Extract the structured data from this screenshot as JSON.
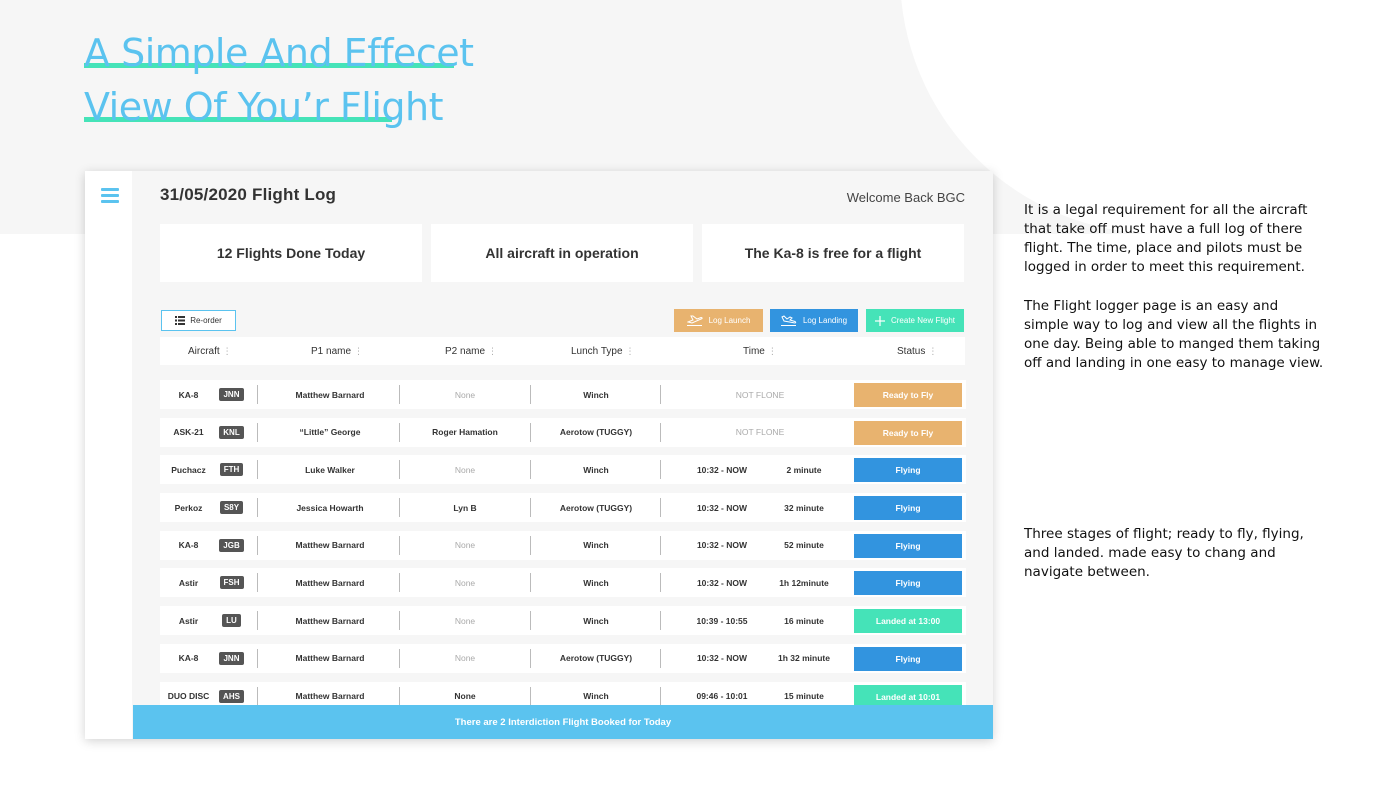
{
  "headline": {
    "line1": "A Simple And Effecet",
    "line2": "View Of You’r Flight"
  },
  "colors": {
    "brand_blue": "#5bc3ef",
    "accent_green": "#45e3b8",
    "ready_orange": "#e8b36f",
    "flying_blue": "#3294df"
  },
  "app": {
    "menu_icon": "hamburger-menu-icon",
    "title": "31/05/2020 Flight Log",
    "welcome": "Welcome Back BGC",
    "stats": [
      "12 Flights Done Today",
      "All aircraft in operation",
      "The Ka-8 is free for a flight"
    ],
    "toolbar": {
      "reorder_label": "Re-order",
      "reorder_icon": "list-icon",
      "log_launch_label": "Log Launch",
      "log_launch_icon": "plane-takeoff-icon",
      "log_landing_label": "Log Landing",
      "log_landing_icon": "plane-landing-icon",
      "create_label": "Create New Flight",
      "create_icon": "plus-icon"
    },
    "columns": [
      "Aircraft",
      "P1 name",
      "P2 name",
      "Lunch Type",
      "Time",
      "Status"
    ],
    "flights": [
      {
        "aircraft": "KA-8",
        "code": "JNN",
        "p1": "Matthew Barnard",
        "p2": "None",
        "type": "Winch",
        "time": "NOT FLONE",
        "duration": "",
        "status": "Ready to Fly",
        "state": "ready"
      },
      {
        "aircraft": "ASK-21",
        "code": "KNL",
        "p1": "“Little” George",
        "p2": "Roger Hamation",
        "type": "Aerotow (TUGGY)",
        "time": "NOT FLONE",
        "duration": "",
        "status": "Ready to Fly",
        "state": "ready"
      },
      {
        "aircraft": "Puchacz",
        "code": "FTH",
        "p1": "Luke Walker",
        "p2": "None",
        "type": "Winch",
        "time": "10:32 - NOW",
        "duration": "2 minute",
        "status": "Flying",
        "state": "flying"
      },
      {
        "aircraft": "Perkoz",
        "code": "S8Y",
        "p1": "Jessica Howarth",
        "p2": "Lyn B",
        "type": "Aerotow (TUGGY)",
        "time": "10:32 - NOW",
        "duration": "32 minute",
        "status": "Flying",
        "state": "flying"
      },
      {
        "aircraft": "KA-8",
        "code": "JGB",
        "p1": "Matthew Barnard",
        "p2": "None",
        "type": "Winch",
        "time": "10:32 - NOW",
        "duration": "52 minute",
        "status": "Flying",
        "state": "flying"
      },
      {
        "aircraft": "Astir",
        "code": "FSH",
        "p1": "Matthew Barnard",
        "p2": "None",
        "type": "Winch",
        "time": "10:32 - NOW",
        "duration": "1h 12minute",
        "status": "Flying",
        "state": "flying"
      },
      {
        "aircraft": "Astir",
        "code": "LU",
        "p1": "Matthew Barnard",
        "p2": "None",
        "type": "Winch",
        "time": "10:39 - 10:55",
        "duration": "16 minute",
        "status": "Landed at 13:00",
        "state": "landed"
      },
      {
        "aircraft": "KA-8",
        "code": "JNN",
        "p1": "Matthew Barnard",
        "p2": "None",
        "type": "Aerotow (TUGGY)",
        "time": "10:32 - NOW",
        "duration": "1h 32 minute",
        "status": "Flying",
        "state": "flying"
      },
      {
        "aircraft": "DUO DISC",
        "code": "AHS",
        "p1": "Matthew Barnard",
        "p2": "None",
        "type": "Winch",
        "time": "09:46 - 10:01",
        "duration": "15 minute",
        "status": "Landed at 10:01",
        "state": "landed"
      }
    ],
    "footer": "There are 2 Interdiction Flight Booked for Today"
  },
  "notes": [
    "It is a legal requirement for all the aircraft that take off must have a full log of there flight. The time, place and pilots must be logged in order to meet this requirement.",
    "The Flight logger page is an easy and simple way to log and view all the flights in one day. Being able to manged them taking off and landing in one easy to manage view.",
    "Three stages of flight; ready to fly, flying, and landed. made easy to chang and navigate between."
  ]
}
